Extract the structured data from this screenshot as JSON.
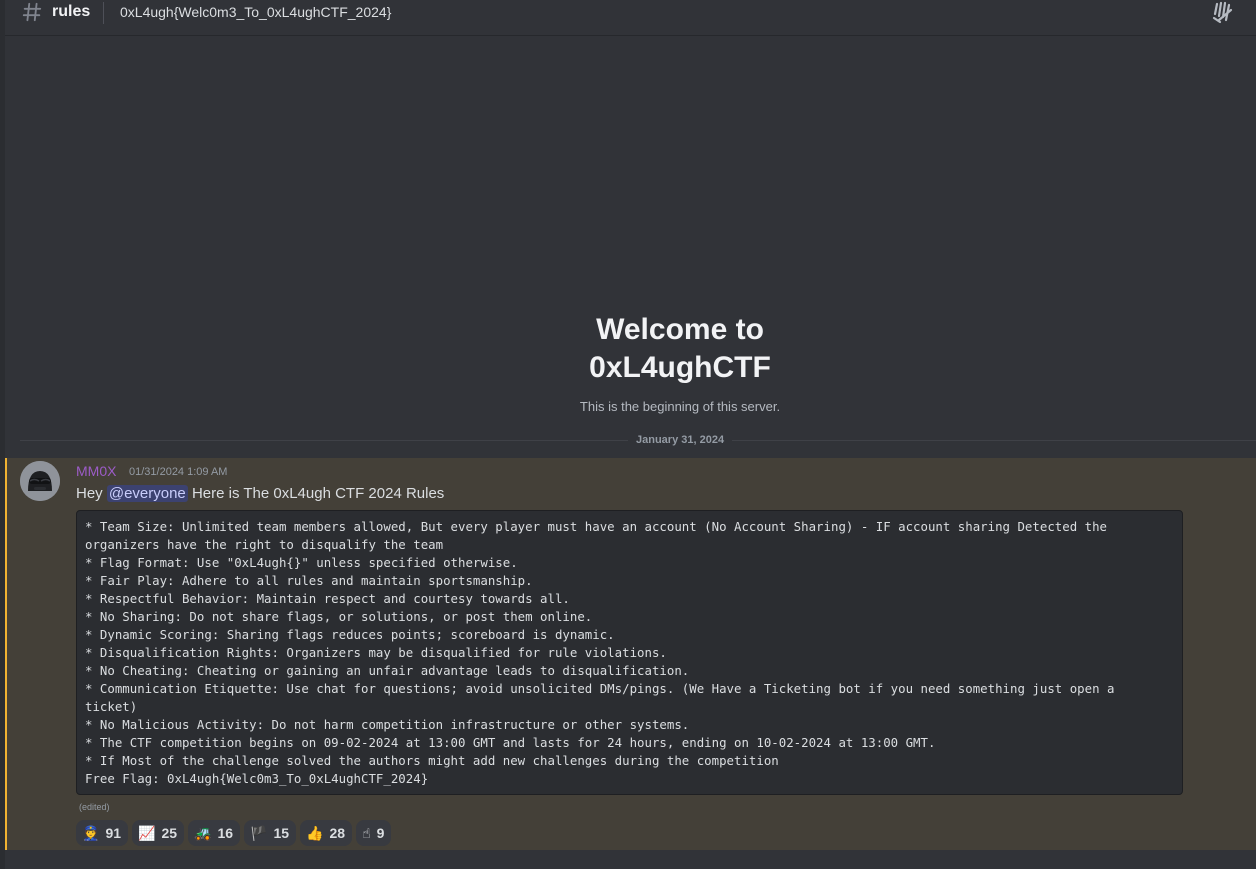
{
  "header": {
    "channel_name": "rules",
    "topic": "0xL4ugh{Welc0m3_To_0xL4ughCTF_2024}",
    "hash_icon": "hash-icon",
    "threads_icon": "threads-icon"
  },
  "welcome": {
    "title_line1": "Welcome to",
    "title_line2": "0xL4ughCTF",
    "subtitle": "This is the beginning of this server."
  },
  "date_divider": "January 31, 2024",
  "message": {
    "author": "MM0X",
    "timestamp": "01/31/2024 1:09 AM",
    "text_before": "Hey ",
    "mention": "@everyone",
    "text_after": "  Here is The 0xL4ugh CTF 2024 Rules",
    "edited": "(edited)",
    "code_lines": [
      "* Team Size: Unlimited team members allowed, But every player must have an account (No Account Sharing) - IF account sharing Detected the organizers have the right to disqualify the team",
      "* Flag Format: Use \"0xL4ugh{}\" unless specified otherwise.",
      "* Fair Play: Adhere to all rules and maintain sportsmanship.",
      "* Respectful Behavior: Maintain respect and courtesy towards all.",
      "* No Sharing: Do not share flags, or solutions, or post them online.",
      "* Dynamic Scoring: Sharing flags reduces points; scoreboard is dynamic.",
      "* Disqualification Rights: Organizers may be disqualified for rule violations.",
      "* No Cheating: Cheating or gaining an unfair advantage leads to disqualification.",
      "* Communication Etiquette: Use chat for questions; avoid unsolicited DMs/pings. (We Have a Ticketing bot if you need something just open a ticket)",
      "* No Malicious Activity: Do not harm competition infrastructure or other systems.",
      "* The CTF competition begins on 09-02-2024 at 13:00 GMT and lasts for 24 hours, ending on 10-02-2024 at 13:00 GMT.",
      "* If Most of the challenge solved the authors might add new challenges during the competition",
      "Free Flag: 0xL4ugh{Welc0m3_To_0xL4ughCTF_2024}"
    ],
    "reactions": [
      {
        "emoji": "👮",
        "count": "91"
      },
      {
        "emoji": "📈",
        "count": "25"
      },
      {
        "emoji": "🚜",
        "count": "16"
      },
      {
        "emoji": "🏴",
        "count": "15"
      },
      {
        "emoji": "👍",
        "count": "28"
      },
      {
        "emoji": "☝",
        "count": "9"
      }
    ]
  },
  "colors": {
    "background": "#313338",
    "mention_highlight": "#444038",
    "mention_bar": "#f0b232",
    "username": "#9c5cc7"
  }
}
